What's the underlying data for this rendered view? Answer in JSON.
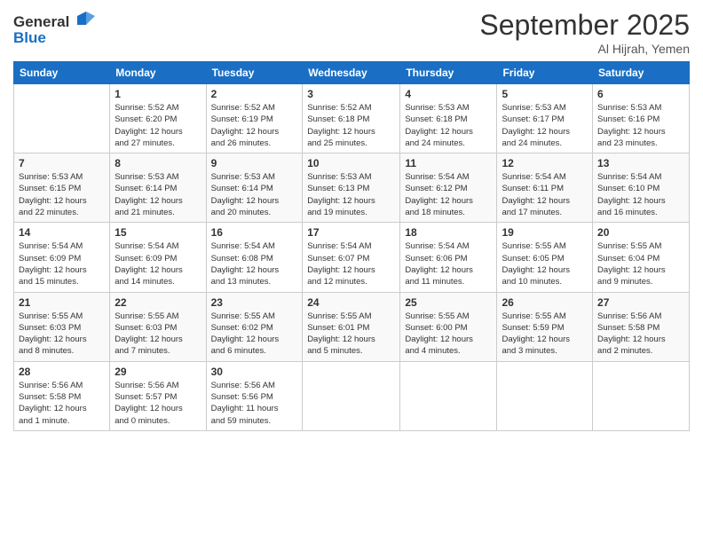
{
  "logo": {
    "line1": "General",
    "line2": "Blue"
  },
  "title": {
    "month": "September 2025",
    "location": "Al Hijrah, Yemen"
  },
  "headers": [
    "Sunday",
    "Monday",
    "Tuesday",
    "Wednesday",
    "Thursday",
    "Friday",
    "Saturday"
  ],
  "weeks": [
    [
      {
        "day": "",
        "info": ""
      },
      {
        "day": "1",
        "info": "Sunrise: 5:52 AM\nSunset: 6:20 PM\nDaylight: 12 hours\nand 27 minutes."
      },
      {
        "day": "2",
        "info": "Sunrise: 5:52 AM\nSunset: 6:19 PM\nDaylight: 12 hours\nand 26 minutes."
      },
      {
        "day": "3",
        "info": "Sunrise: 5:52 AM\nSunset: 6:18 PM\nDaylight: 12 hours\nand 25 minutes."
      },
      {
        "day": "4",
        "info": "Sunrise: 5:53 AM\nSunset: 6:18 PM\nDaylight: 12 hours\nand 24 minutes."
      },
      {
        "day": "5",
        "info": "Sunrise: 5:53 AM\nSunset: 6:17 PM\nDaylight: 12 hours\nand 24 minutes."
      },
      {
        "day": "6",
        "info": "Sunrise: 5:53 AM\nSunset: 6:16 PM\nDaylight: 12 hours\nand 23 minutes."
      }
    ],
    [
      {
        "day": "7",
        "info": "Sunrise: 5:53 AM\nSunset: 6:15 PM\nDaylight: 12 hours\nand 22 minutes."
      },
      {
        "day": "8",
        "info": "Sunrise: 5:53 AM\nSunset: 6:14 PM\nDaylight: 12 hours\nand 21 minutes."
      },
      {
        "day": "9",
        "info": "Sunrise: 5:53 AM\nSunset: 6:14 PM\nDaylight: 12 hours\nand 20 minutes."
      },
      {
        "day": "10",
        "info": "Sunrise: 5:53 AM\nSunset: 6:13 PM\nDaylight: 12 hours\nand 19 minutes."
      },
      {
        "day": "11",
        "info": "Sunrise: 5:54 AM\nSunset: 6:12 PM\nDaylight: 12 hours\nand 18 minutes."
      },
      {
        "day": "12",
        "info": "Sunrise: 5:54 AM\nSunset: 6:11 PM\nDaylight: 12 hours\nand 17 minutes."
      },
      {
        "day": "13",
        "info": "Sunrise: 5:54 AM\nSunset: 6:10 PM\nDaylight: 12 hours\nand 16 minutes."
      }
    ],
    [
      {
        "day": "14",
        "info": "Sunrise: 5:54 AM\nSunset: 6:09 PM\nDaylight: 12 hours\nand 15 minutes."
      },
      {
        "day": "15",
        "info": "Sunrise: 5:54 AM\nSunset: 6:09 PM\nDaylight: 12 hours\nand 14 minutes."
      },
      {
        "day": "16",
        "info": "Sunrise: 5:54 AM\nSunset: 6:08 PM\nDaylight: 12 hours\nand 13 minutes."
      },
      {
        "day": "17",
        "info": "Sunrise: 5:54 AM\nSunset: 6:07 PM\nDaylight: 12 hours\nand 12 minutes."
      },
      {
        "day": "18",
        "info": "Sunrise: 5:54 AM\nSunset: 6:06 PM\nDaylight: 12 hours\nand 11 minutes."
      },
      {
        "day": "19",
        "info": "Sunrise: 5:55 AM\nSunset: 6:05 PM\nDaylight: 12 hours\nand 10 minutes."
      },
      {
        "day": "20",
        "info": "Sunrise: 5:55 AM\nSunset: 6:04 PM\nDaylight: 12 hours\nand 9 minutes."
      }
    ],
    [
      {
        "day": "21",
        "info": "Sunrise: 5:55 AM\nSunset: 6:03 PM\nDaylight: 12 hours\nand 8 minutes."
      },
      {
        "day": "22",
        "info": "Sunrise: 5:55 AM\nSunset: 6:03 PM\nDaylight: 12 hours\nand 7 minutes."
      },
      {
        "day": "23",
        "info": "Sunrise: 5:55 AM\nSunset: 6:02 PM\nDaylight: 12 hours\nand 6 minutes."
      },
      {
        "day": "24",
        "info": "Sunrise: 5:55 AM\nSunset: 6:01 PM\nDaylight: 12 hours\nand 5 minutes."
      },
      {
        "day": "25",
        "info": "Sunrise: 5:55 AM\nSunset: 6:00 PM\nDaylight: 12 hours\nand 4 minutes."
      },
      {
        "day": "26",
        "info": "Sunrise: 5:55 AM\nSunset: 5:59 PM\nDaylight: 12 hours\nand 3 minutes."
      },
      {
        "day": "27",
        "info": "Sunrise: 5:56 AM\nSunset: 5:58 PM\nDaylight: 12 hours\nand 2 minutes."
      }
    ],
    [
      {
        "day": "28",
        "info": "Sunrise: 5:56 AM\nSunset: 5:58 PM\nDaylight: 12 hours\nand 1 minute."
      },
      {
        "day": "29",
        "info": "Sunrise: 5:56 AM\nSunset: 5:57 PM\nDaylight: 12 hours\nand 0 minutes."
      },
      {
        "day": "30",
        "info": "Sunrise: 5:56 AM\nSunset: 5:56 PM\nDaylight: 11 hours\nand 59 minutes."
      },
      {
        "day": "",
        "info": ""
      },
      {
        "day": "",
        "info": ""
      },
      {
        "day": "",
        "info": ""
      },
      {
        "day": "",
        "info": ""
      }
    ]
  ]
}
